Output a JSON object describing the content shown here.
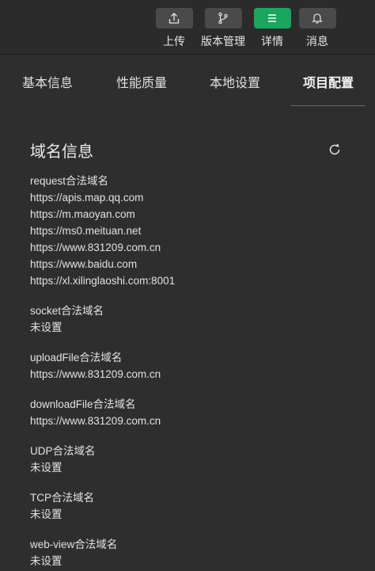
{
  "toolbar": {
    "buttons": [
      {
        "label": "上传",
        "icon": "upload-icon"
      },
      {
        "label": "版本管理",
        "icon": "branch-icon"
      },
      {
        "label": "详情",
        "icon": "menu-icon",
        "active": true
      },
      {
        "label": "消息",
        "icon": "bell-icon"
      }
    ],
    "active_color": "#19a760"
  },
  "tabs": [
    "基本信息",
    "性能质量",
    "本地设置",
    "项目配置"
  ],
  "active_tab": "项目配置",
  "domain_info": {
    "title": "域名信息",
    "refresh_icon": "refresh-icon",
    "sections": [
      {
        "label": "request合法域名",
        "values": [
          "https://apis.map.qq.com",
          "https://m.maoyan.com",
          "https://ms0.meituan.net",
          "https://www.831209.com.cn",
          "https://www.baidu.com",
          "https://xl.xilinglaoshi.com:8001"
        ]
      },
      {
        "label": "socket合法域名",
        "values": [
          "未设置"
        ]
      },
      {
        "label": "uploadFile合法域名",
        "values": [
          "https://www.831209.com.cn"
        ]
      },
      {
        "label": "downloadFile合法域名",
        "values": [
          "https://www.831209.com.cn"
        ]
      },
      {
        "label": "UDP合法域名",
        "values": [
          "未设置"
        ]
      },
      {
        "label": "TCP合法域名",
        "values": [
          "未设置"
        ]
      },
      {
        "label": "web-view合法域名",
        "values": [
          "未设置"
        ]
      }
    ]
  }
}
